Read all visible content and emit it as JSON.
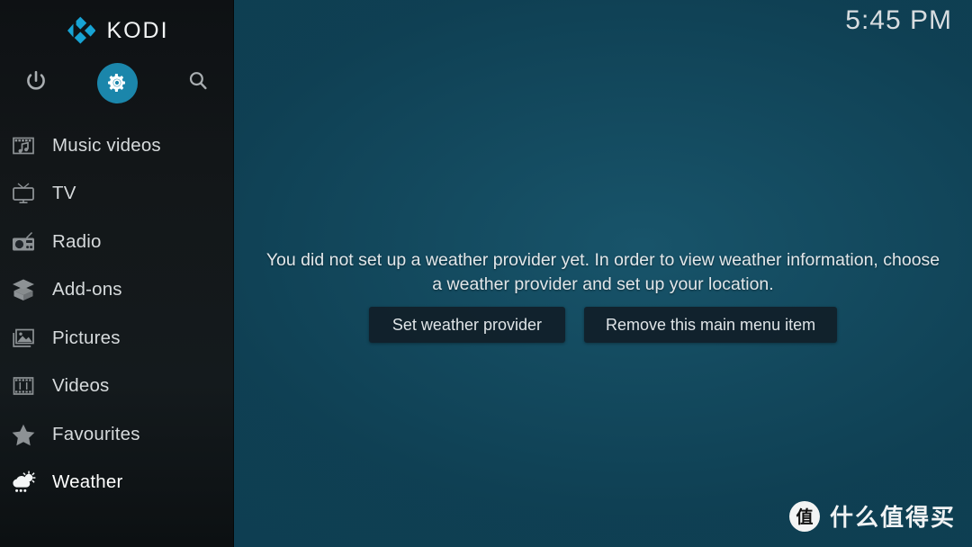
{
  "app": {
    "brand_name": "KODI",
    "logo_icon": "kodi-logo-icon"
  },
  "topbar": {
    "clock": "5:45 PM",
    "buttons": [
      {
        "name": "power-button",
        "icon": "power-icon",
        "label": "Power"
      },
      {
        "name": "settings-button",
        "icon": "gear-icon",
        "label": "Settings",
        "selected": true,
        "accent": "#1b86ab"
      },
      {
        "name": "search-button",
        "icon": "search-icon",
        "label": "Search"
      }
    ]
  },
  "sidebar": {
    "items": [
      {
        "label": "Music videos",
        "icon": "music-video-icon",
        "selected": false
      },
      {
        "label": "TV",
        "icon": "tv-icon",
        "selected": false
      },
      {
        "label": "Radio",
        "icon": "radio-icon",
        "selected": false
      },
      {
        "label": "Add-ons",
        "icon": "addons-box-icon",
        "selected": false
      },
      {
        "label": "Pictures",
        "icon": "pictures-icon",
        "selected": false
      },
      {
        "label": "Videos",
        "icon": "film-strip-icon",
        "selected": false
      },
      {
        "label": "Favourites",
        "icon": "star-icon",
        "selected": false
      },
      {
        "label": "Weather",
        "icon": "weather-cloud-sun-rain-icon",
        "selected": true
      }
    ]
  },
  "main": {
    "message": "You did not set up a weather provider yet. In order to view weather information, choose a weather provider and set up your location.",
    "actions": [
      {
        "label": "Set weather provider"
      },
      {
        "label": "Remove this main menu item"
      }
    ]
  },
  "watermark": {
    "badge_char": "值",
    "text": "什么值得买"
  },
  "colors": {
    "accent": "#1b86ab",
    "sidebar_bg": "#131719",
    "main_bg": "#115064",
    "button_bg": "#111c26",
    "text": "#dfe4e7"
  }
}
